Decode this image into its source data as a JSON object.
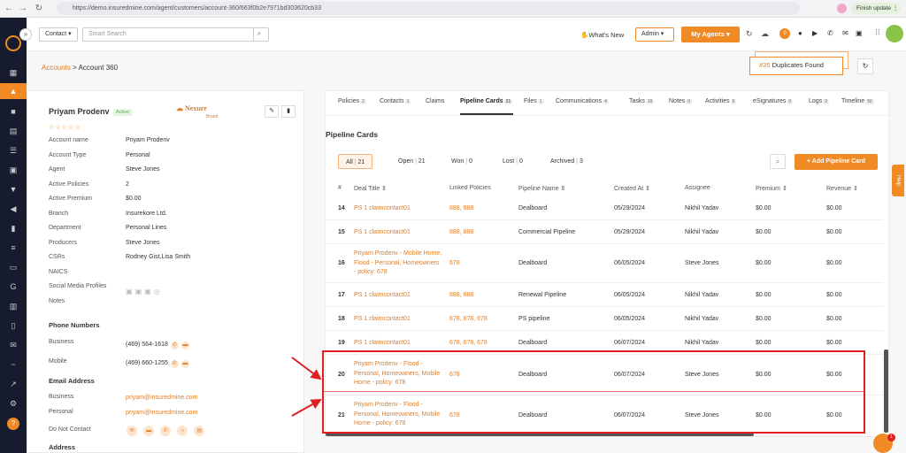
{
  "browser": {
    "url": "https://demo.insuredmine.com/agent/customers/account-360/663f0b2e7971bd303620cb33",
    "finish": "Finish update"
  },
  "topbar": {
    "contact_select": "Contact",
    "search_placeholder": "Smart Search",
    "whats_new": "What's New",
    "role": "Admin",
    "my_agents": "My Agents",
    "badge": "0"
  },
  "breadcrumb": {
    "root": "Accounts",
    "sep": ">",
    "current": "Account 360"
  },
  "duplicates": {
    "count": "#35",
    "label": "Duplicates Found"
  },
  "account": {
    "name": "Priyam Prodenv",
    "status": "Active",
    "logo_text": "Nexure",
    "logo_sub": "Brand",
    "stars": "☆☆☆☆☆",
    "fields": [
      {
        "k": "Account name",
        "v": "Priyam Prodenv"
      },
      {
        "k": "Account Type",
        "v": "Personal"
      },
      {
        "k": "Agent",
        "v": "Steve Jones"
      },
      {
        "k": "Active Policies",
        "v": "2"
      },
      {
        "k": "Active Premium",
        "v": "$0.00"
      },
      {
        "k": "Branch",
        "v": "Insurekore Ltd."
      },
      {
        "k": "Department",
        "v": "Personal Lines"
      },
      {
        "k": "Producers",
        "v": "Steve Jones"
      },
      {
        "k": "CSRs",
        "v": "Rodney Gist,Lisa Smith"
      },
      {
        "k": "NAICS",
        "v": ""
      },
      {
        "k": "Social Media Profiles",
        "v": ""
      },
      {
        "k": "Notes",
        "v": ""
      }
    ],
    "phone_header": "Phone Numbers",
    "phones": [
      {
        "k": "Business",
        "v": "(469) 564-1618"
      },
      {
        "k": "Mobile",
        "v": "(469) 660-1255"
      }
    ],
    "email_header": "Email Address",
    "emails": [
      {
        "k": "Business",
        "v": "priyam@insuredmine.com"
      },
      {
        "k": "Personal",
        "v": "priyam@insuredmine.com"
      }
    ],
    "dnc": "Do Not Contact",
    "address_header": "Address"
  },
  "tabs": [
    {
      "label": "Policies",
      "count": "2"
    },
    {
      "label": "Contacts",
      "count": "1"
    },
    {
      "label": "Claims",
      "count": ""
    },
    {
      "label": "Pipeline Cards",
      "count": "21"
    },
    {
      "label": "Files",
      "count": "1"
    },
    {
      "label": "Communications",
      "count": "4"
    },
    {
      "label": "Tasks",
      "count": "19"
    },
    {
      "label": "Notes",
      "count": "0"
    },
    {
      "label": "Activities",
      "count": "5"
    },
    {
      "label": "eSignatures",
      "count": "0"
    },
    {
      "label": "Logs",
      "count": "0"
    },
    {
      "label": "Timeline",
      "count": "56"
    }
  ],
  "pipeline": {
    "title": "Pipeline Cards",
    "filters": [
      {
        "label": "All",
        "count": "21"
      },
      {
        "label": "Open",
        "count": "21"
      },
      {
        "label": "Won",
        "count": "0"
      },
      {
        "label": "Lost",
        "count": "0"
      },
      {
        "label": "Archived",
        "count": "3"
      }
    ],
    "add_label": "+ Add Pipeline Card",
    "columns": [
      "#",
      "Deal Title ⇕",
      "Linked Policies",
      "Pipeline Name ⇕",
      "Created At ⇕",
      "Assignee",
      "Premium ⇕",
      "Revenue ⇕"
    ],
    "rows": [
      {
        "n": "14",
        "title": "PS 1 claimcontact01",
        "pol": "888, 888",
        "pipe": "Dealboard",
        "date": "05/29/2024",
        "asg": "Nikhil Yadav",
        "prem": "$0.00",
        "rev": "$0.00"
      },
      {
        "n": "15",
        "title": "PS 1 claimcontact01",
        "pol": "888, 888",
        "pipe": "Commercial Pipeline",
        "date": "05/29/2024",
        "asg": "Nikhil Yadav",
        "prem": "$0.00",
        "rev": "$0.00"
      },
      {
        "n": "16",
        "title": "Priyam Prodenv - Mobile Home, Flood - Personal, Homeowners - policy: 678",
        "pol": "678",
        "pipe": "Dealboard",
        "date": "06/05/2024",
        "asg": "Steve Jones",
        "prem": "$0.00",
        "rev": "$0.00"
      },
      {
        "n": "17",
        "title": "PS 1 claimcontact01",
        "pol": "888, 888",
        "pipe": "Renewal Pipeline",
        "date": "06/05/2024",
        "asg": "Nikhil Yadav",
        "prem": "$0.00",
        "rev": "$0.00"
      },
      {
        "n": "18",
        "title": "PS 1 claimcontact01",
        "pol": "678, 678, 678",
        "pipe": "PS pipeline",
        "date": "06/05/2024",
        "asg": "Nikhil Yadav",
        "prem": "$0.00",
        "rev": "$0.00"
      },
      {
        "n": "19",
        "title": "PS 1 claimcontact01",
        "pol": "678, 678, 678",
        "pipe": "Dealboard",
        "date": "06/07/2024",
        "asg": "Nikhil Yadav",
        "prem": "$0.00",
        "rev": "$0.00"
      },
      {
        "n": "20",
        "title": "Priyam Prodenv - Flood - Personal, Homeowners, Mobile Home - policy: 678",
        "pol": "678",
        "pipe": "Dealboard",
        "date": "06/07/2024",
        "asg": "Steve Jones",
        "prem": "$0.00",
        "rev": "$0.00"
      },
      {
        "n": "21",
        "title": "Priyam Prodenv - Flood - Personal, Homeowners, Mobile Home - policy: 678",
        "pol": "678",
        "pipe": "Dealboard",
        "date": "06/07/2024",
        "asg": "Steve Jones",
        "prem": "$0.00",
        "rev": "$0.00"
      }
    ]
  },
  "help": "Help",
  "chat_badge": "1",
  "colors": {
    "accent": "#f08a24",
    "sidebar": "#161b2e",
    "highlight": "#e02020"
  }
}
